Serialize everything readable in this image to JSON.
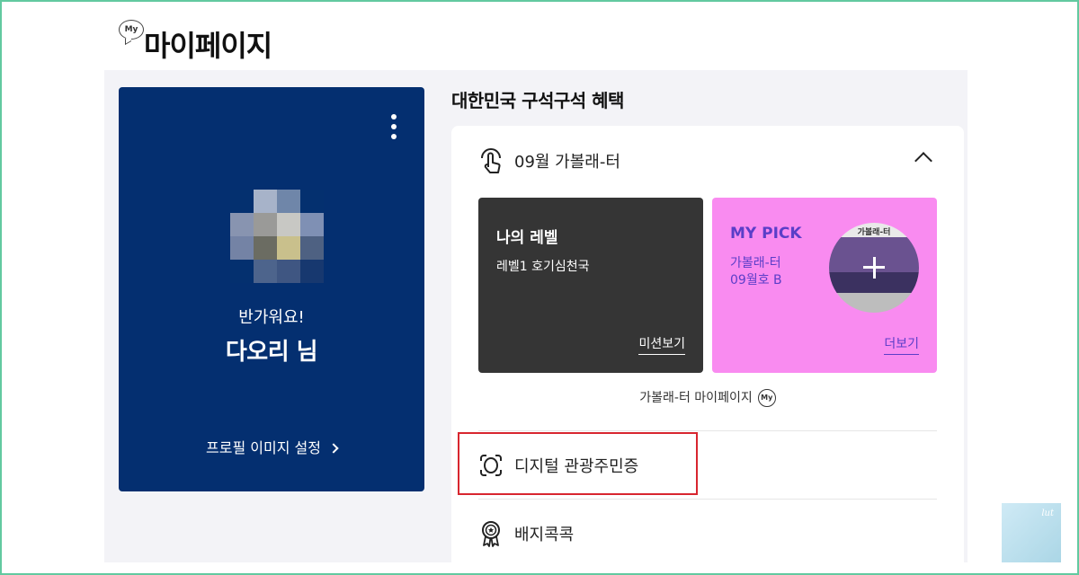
{
  "header": {
    "my_icon_text": "My",
    "title": "마이페이지"
  },
  "profile": {
    "greeting": "반가워요!",
    "name": "다오리 님",
    "settings_link": "프로필 이미지 설정",
    "avatar_pixels": [
      "#04306f",
      "#a7b3c9",
      "#6f86a9",
      "#04306f",
      "#8894b0",
      "#9a9a98",
      "#c8c8c4",
      "#7f90b4",
      "#7483a5",
      "#6b6c62",
      "#c9c08c",
      "#4e6182",
      "#04306f",
      "#4d648c",
      "#3f5682",
      "#17386f"
    ]
  },
  "benefits": {
    "section_title": "대한민국 구석구석 혜택",
    "accordion_title": "09월 가볼래-터",
    "level_card": {
      "title": "나의 레벨",
      "description": "레벨1 호기심천국",
      "link": "미션보기"
    },
    "pick_card": {
      "title": "MY PICK",
      "line1": "가볼래-터",
      "line2": "09월호 B",
      "cover_label": "가볼래-터",
      "link": "더보기"
    },
    "mypage_link": "가볼래-터 마이페이지",
    "mypage_icon_text": "My"
  },
  "menu": {
    "digital_resident": "디지털 관광주민증",
    "badges": "배지콕콕"
  },
  "watermark": {
    "text": "lut"
  },
  "colors": {
    "profile_bg": "#042f70",
    "level_card_bg": "#353535",
    "pick_card_bg": "#f98bf0",
    "pick_text": "#5b3ec8",
    "highlight": "#d8262f",
    "frame": "#62c9a0"
  }
}
